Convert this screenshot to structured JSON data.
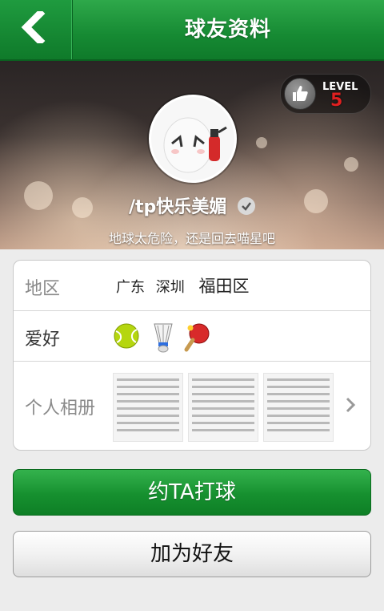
{
  "header": {
    "title": "球友资料",
    "back_icon": "chevron-left-icon"
  },
  "profile": {
    "level_label": "LEVEL",
    "level_value": "5",
    "name": "/tp快乐美媚",
    "signature": "地球太危险，还是回去喵星吧",
    "verified_icon": "check-badge-icon"
  },
  "info": {
    "region_label": "地区",
    "region_province": "广东",
    "region_city": "深圳",
    "region_district": "福田区",
    "hobby_label": "爱好",
    "hobbies": [
      "tennis",
      "badminton",
      "table-tennis"
    ],
    "album_label": "个人相册"
  },
  "actions": {
    "play_label": "约TA打球",
    "add_friend_label": "加为好友"
  },
  "colors": {
    "primary_green": "#16902f",
    "level_red": "#e02020"
  }
}
